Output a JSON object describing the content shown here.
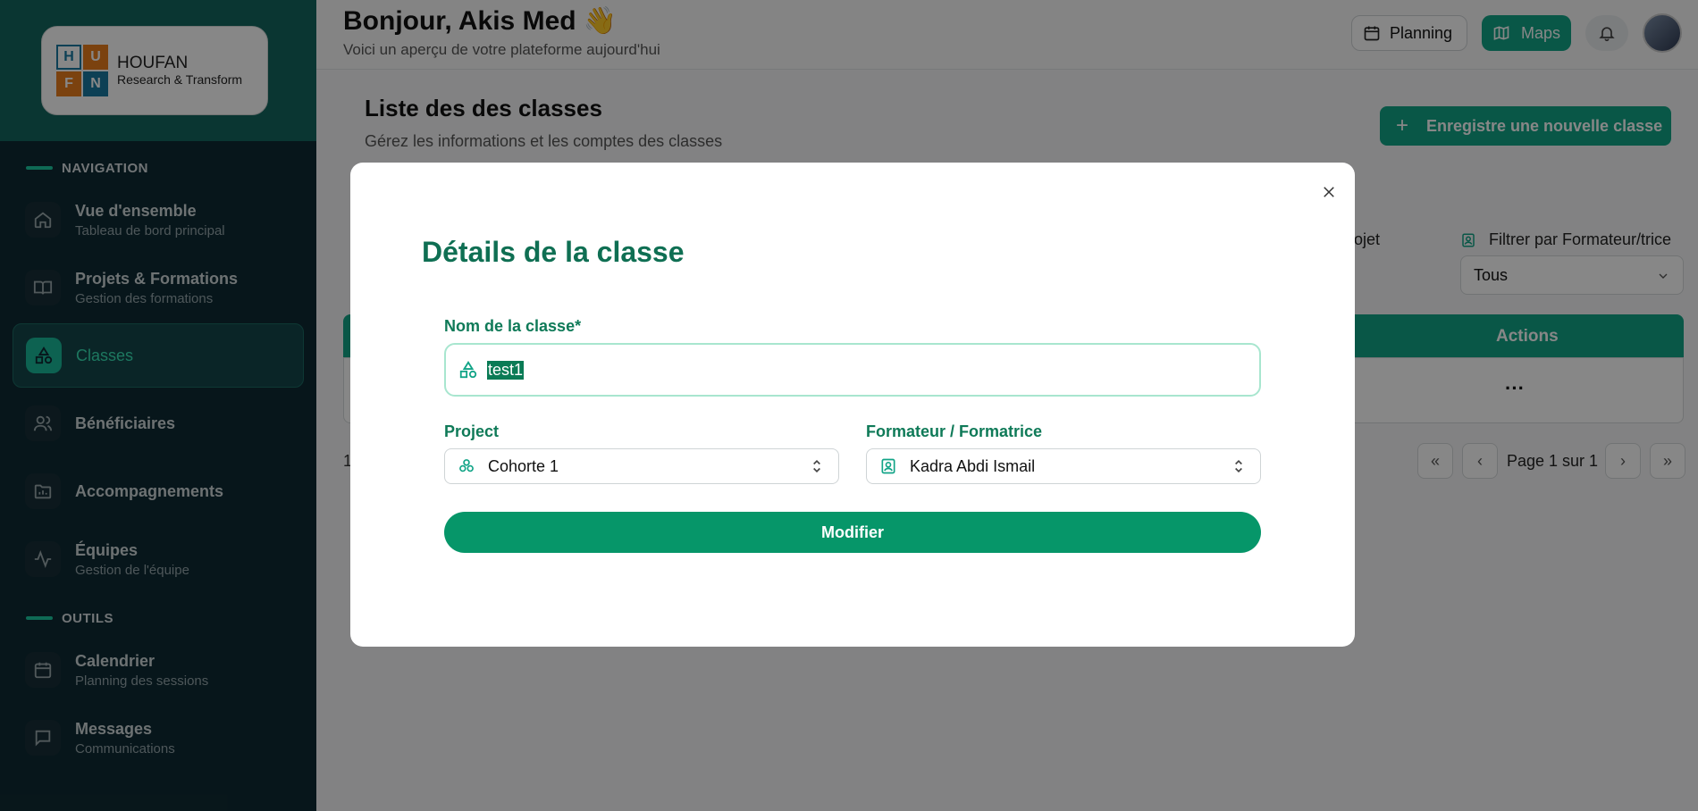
{
  "brand": {
    "name": "HOUFAN",
    "tagline": "Research & Transform",
    "letters": [
      "H",
      "U",
      "F",
      "N"
    ]
  },
  "sidebar": {
    "section_nav": "NAVIGATION",
    "section_tools": "OUTILS",
    "items": [
      {
        "label": "Vue d'ensemble",
        "sub": "Tableau de bord principal",
        "icon": "home-icon"
      },
      {
        "label": "Projets & Formations",
        "sub": "Gestion des formations",
        "icon": "book-icon"
      },
      {
        "label": "Classes",
        "sub": "",
        "icon": "shapes-icon"
      },
      {
        "label": "Bénéficiaires",
        "sub": "",
        "icon": "users-icon"
      },
      {
        "label": "Accompagnements",
        "sub": "",
        "icon": "folder-icon"
      },
      {
        "label": "Équipes",
        "sub": "Gestion de l'équipe",
        "icon": "activity-icon"
      }
    ],
    "tools": [
      {
        "label": "Calendrier",
        "sub": "Planning des sessions",
        "icon": "calendar-icon"
      },
      {
        "label": "Messages",
        "sub": "Communications",
        "icon": "message-icon"
      }
    ]
  },
  "header": {
    "greeting": "Bonjour, Akis Med 👋",
    "subtitle": "Voici un aperçu de votre plateforme aujourd'hui",
    "planning_label": "Planning",
    "maps_label": "Maps"
  },
  "content": {
    "title": "Liste des des classes",
    "subtitle": "Gérez les informations et les comptes des classes",
    "new_button": "Enregistre une nouvelle classe",
    "filter_project_partial": "ojet",
    "filter_trainer_label": "Filtrer par Formateur/trice",
    "filter_trainer_value": "Tous",
    "actions_header": "Actions",
    "row_actions": "···",
    "count_partial": "1",
    "pagination": "Page 1 sur 1"
  },
  "modal": {
    "title": "Détails de la classe",
    "name_label": "Nom de la classe*",
    "name_value": "test1",
    "project_label": "Project",
    "project_value": "Cohorte 1",
    "trainer_label": "Formateur / Formatrice",
    "trainer_value": "Kadra Abdi Ismail",
    "submit_label": "Modifier"
  },
  "colors": {
    "accent": "#12a487",
    "sidebar_bg": "#0f2b33",
    "modal_title": "#0f6f53"
  }
}
